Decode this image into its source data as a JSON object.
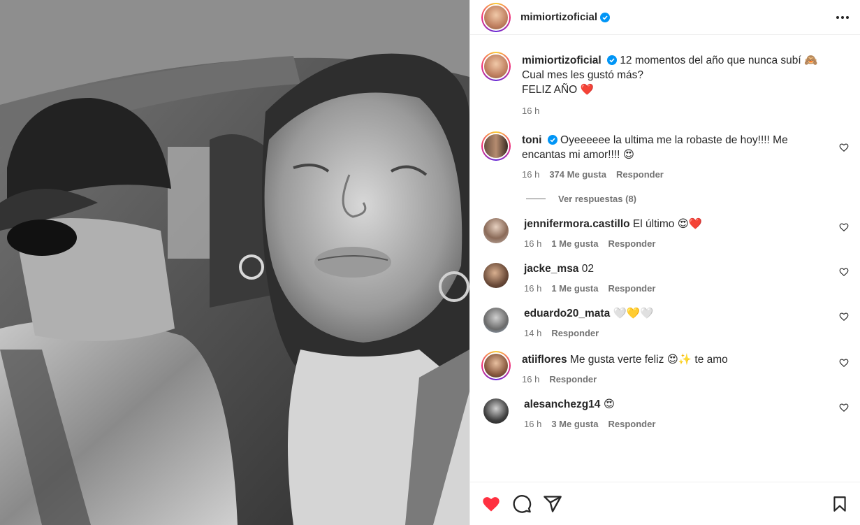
{
  "post": {
    "author": "mimiortizoficial",
    "caption_line1": "12 momentos del año que nunca subí 🙈",
    "caption_line2": "Cual mes les gustó más?",
    "caption_line3": "FELIZ AÑO ❤️",
    "time": "16 h"
  },
  "comments": [
    {
      "user": "toni",
      "verified": true,
      "text_line1": "Oyeeeeee la ultima me la robaste de hoy!!!! Me",
      "text_line2": "encantas mi amor!!!! 😍",
      "time": "16 h",
      "likes": "374 Me gusta",
      "reply": "Responder",
      "view_replies": "Ver respuestas (8)"
    },
    {
      "user": "jennifermora.castillo",
      "text": "El último 😍❤️",
      "time": "16 h",
      "likes": "1 Me gusta",
      "reply": "Responder"
    },
    {
      "user": "jacke_msa",
      "text": "02",
      "time": "16 h",
      "likes": "1 Me gusta",
      "reply": "Responder"
    },
    {
      "user": "eduardo20_mata",
      "text": "🤍💛🤍",
      "time": "14 h",
      "reply": "Responder"
    },
    {
      "user": "atiiflores",
      "text": "Me gusta verte feliz 😍✨ te amo",
      "time": "16 h",
      "reply": "Responder"
    },
    {
      "user": "alesanchezg14",
      "text": "😍",
      "time": "16 h",
      "likes": "3 Me gusta",
      "reply": "Responder"
    }
  ],
  "icons": {
    "like": "heart-filled-icon",
    "comment": "comment-icon",
    "share": "send-icon",
    "save": "bookmark-icon",
    "more": "more-options-icon"
  },
  "colors": {
    "like_red": "#ff3040",
    "verified_blue": "#0095f6",
    "secondary_text": "#737373"
  }
}
